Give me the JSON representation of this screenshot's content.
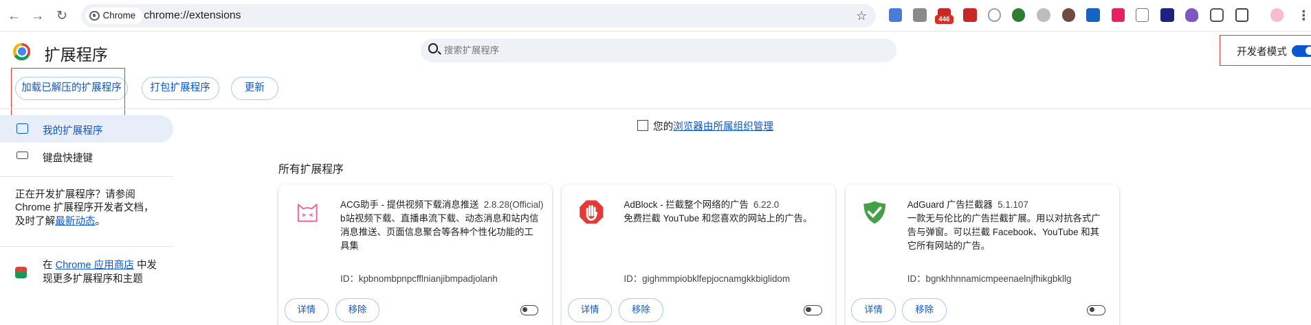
{
  "browser": {
    "chip_label": "Chrome",
    "url": "chrome://extensions",
    "notification_badge": "446",
    "badge_color": "#d93025"
  },
  "header": {
    "title": "扩展程序",
    "search_placeholder": "搜索扩展程序",
    "dev_mode_label": "开发者模式",
    "dev_mode_enabled": true
  },
  "toolbar": {
    "load_unpacked": "加载已解压的扩展程序",
    "pack": "打包扩展程序",
    "update": "更新"
  },
  "sidebar": {
    "my_extensions": "我的扩展程序",
    "shortcuts": "键盘快捷键",
    "dev_text_1": "正在开发扩展程序？请参阅",
    "dev_text_2": "Chrome 扩展程序开发者文档，",
    "dev_text_3": "及时了解",
    "dev_link": "最新动态",
    "dev_text_4": "。",
    "store_text_1": "在 ",
    "store_link": "Chrome 应用商店",
    "store_text_2": " 中发",
    "store_text_3": "现更多扩展程序和主题"
  },
  "main": {
    "managed_prefix": "您的",
    "managed_link": "浏览器由所属组织管理",
    "section_title": "所有扩展程序",
    "accent": "#0b57d0",
    "cards": [
      {
        "name": "ACG助手 - 提供视频下载消息推送",
        "version": "2.8.28(Official)",
        "description": "b站视频下载、直播串流下载、动态消息和站内信消息推送、页面信息聚合等各种个性化功能的工具集",
        "id": "ID：kpbnombpnpcfflnianjibmpadjolanh",
        "details": "详情",
        "remove": "移除",
        "icon": "cat-icon",
        "enabled": false
      },
      {
        "name": "AdBlock - 拦截整个网络的广告",
        "version": "6.22.0",
        "description": "免费拦截 YouTube 和您喜欢的网站上的广告。",
        "id": "ID：gighmmpiobklfepjocnamgkkbiglidom",
        "details": "详情",
        "remove": "移除",
        "icon": "adblock-hand-icon",
        "enabled": false
      },
      {
        "name": "AdGuard 广告拦截器",
        "version": "5.1.107",
        "description": "一款无与伦比的广告拦截扩展。用以对抗各式广告与弹窗。可以拦截 Facebook、YouTube 和其它所有网站的广告。",
        "id": "ID：bgnkhhnnamicmpeenaelnjfhikgbkllg",
        "details": "详情",
        "remove": "移除",
        "icon": "adguard-shield-icon",
        "enabled": false
      }
    ]
  }
}
